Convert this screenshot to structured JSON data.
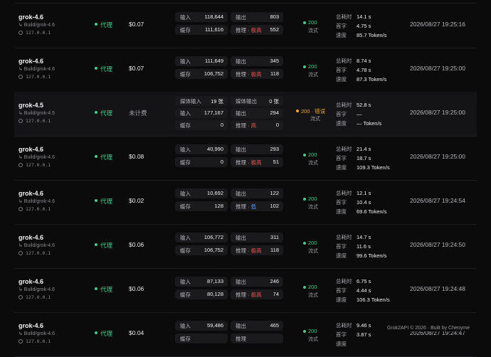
{
  "rows": [
    {
      "model": "grok-4.6",
      "route": "↳ Build/grok-4.6",
      "ip": "127.0.0.1",
      "agent": "代理",
      "cost": "$0.07",
      "cost_muted": false,
      "tokens": [
        {
          "a_label": "输入",
          "a_value": "118,644",
          "b_label": "输出",
          "b_value": "803"
        },
        {
          "a_label": "缓存",
          "a_value": "111,616",
          "b_label": "推理",
          "b_level": "极高",
          "b_level_kind": "extreme",
          "b_value": "552"
        }
      ],
      "status": "200",
      "status_error": false,
      "mode": "流式",
      "timing": [
        {
          "k": "总耗时",
          "v": "14.1 s"
        },
        {
          "k": "首字",
          "v": "4.75 s"
        },
        {
          "k": "速度",
          "v": "85.7 Token/s"
        }
      ],
      "time": "2026/08/27 19:25:16"
    },
    {
      "model": "grok-4.6",
      "route": "↳ Build/grok-4.6",
      "ip": "127.0.0.1",
      "agent": "代理",
      "cost": "$0.07",
      "cost_muted": false,
      "tokens": [
        {
          "a_label": "输入",
          "a_value": "111,649",
          "b_label": "输出",
          "b_value": "345"
        },
        {
          "a_label": "缓存",
          "a_value": "106,752",
          "b_label": "推理",
          "b_level": "极高",
          "b_level_kind": "extreme",
          "b_value": "118"
        }
      ],
      "status": "200",
      "status_error": false,
      "mode": "流式",
      "timing": [
        {
          "k": "总耗时",
          "v": "8.74 s"
        },
        {
          "k": "首字",
          "v": "4.78 s"
        },
        {
          "k": "速度",
          "v": "87.3 Token/s"
        }
      ],
      "time": "2026/08/27 19:25:00"
    },
    {
      "model": "grok-4.5",
      "route": "↳ Build/grok-4.5",
      "ip": "127.0.0.1",
      "agent": "代理",
      "cost": "未计费",
      "cost_muted": true,
      "highlight": true,
      "tokens": [
        {
          "a_label": "媒体输入",
          "a_value": "19 张",
          "b_label": "媒体输出",
          "b_value": "0 张"
        },
        {
          "a_label": "输入",
          "a_value": "177,167",
          "b_label": "输出",
          "b_value": "294"
        },
        {
          "a_label": "缓存",
          "a_value": "0",
          "b_label": "推理",
          "b_level": "高",
          "b_level_kind": "high",
          "b_value": "0"
        }
      ],
      "status": "200 · 错误",
      "status_error": true,
      "mode": "流式",
      "timing": [
        {
          "k": "总耗时",
          "v": "52.8 s"
        },
        {
          "k": "首字",
          "v": "—"
        },
        {
          "k": "速度",
          "v": "— Token/s"
        }
      ],
      "time": "2026/08/27 19:25:00"
    },
    {
      "model": "grok-4.6",
      "route": "↳ Build/grok-4.6",
      "ip": "127.0.0.1",
      "agent": "代理",
      "cost": "$0.08",
      "cost_muted": false,
      "tokens": [
        {
          "a_label": "输入",
          "a_value": "40,990",
          "b_label": "输出",
          "b_value": "293"
        },
        {
          "a_label": "缓存",
          "a_value": "0",
          "b_label": "推理",
          "b_level": "极高",
          "b_level_kind": "extreme",
          "b_value": "51"
        }
      ],
      "status": "200",
      "status_error": false,
      "mode": "流式",
      "timing": [
        {
          "k": "总耗时",
          "v": "21.4 s"
        },
        {
          "k": "首字",
          "v": "18.7 s"
        },
        {
          "k": "速度",
          "v": "109.3 Token/s"
        }
      ],
      "time": "2026/08/27 19:25:00"
    },
    {
      "model": "grok-4.6",
      "route": "↳ Build/grok-4.6",
      "ip": "127.0.0.1",
      "agent": "代理",
      "cost": "$0.02",
      "cost_muted": false,
      "tokens": [
        {
          "a_label": "输入",
          "a_value": "10,692",
          "b_label": "输出",
          "b_value": "122"
        },
        {
          "a_label": "缓存",
          "a_value": "128",
          "b_label": "推理",
          "b_level": "低",
          "b_level_kind": "low",
          "b_value": "102"
        }
      ],
      "status": "200",
      "status_error": false,
      "mode": "流式",
      "timing": [
        {
          "k": "总耗时",
          "v": "12.1 s"
        },
        {
          "k": "首字",
          "v": "10.4 s"
        },
        {
          "k": "速度",
          "v": "69.6 Token/s"
        }
      ],
      "time": "2026/08/27 19:24:54"
    },
    {
      "model": "grok-4.6",
      "route": "↳ Build/grok-4.6",
      "ip": "127.0.0.1",
      "agent": "代理",
      "cost": "$0.06",
      "cost_muted": false,
      "tokens": [
        {
          "a_label": "输入",
          "a_value": "106,772",
          "b_label": "输出",
          "b_value": "311"
        },
        {
          "a_label": "缓存",
          "a_value": "106,752",
          "b_label": "推理",
          "b_level": "极高",
          "b_level_kind": "extreme",
          "b_value": "118"
        }
      ],
      "status": "200",
      "status_error": false,
      "mode": "流式",
      "timing": [
        {
          "k": "总耗时",
          "v": "14.7 s"
        },
        {
          "k": "首字",
          "v": "11.6 s"
        },
        {
          "k": "速度",
          "v": "99.6 Token/s"
        }
      ],
      "time": "2026/08/27 19:24:50"
    },
    {
      "model": "grok-4.6",
      "route": "↳ Build/grok-4.6",
      "ip": "127.0.0.1",
      "agent": "代理",
      "cost": "$0.06",
      "cost_muted": false,
      "tokens": [
        {
          "a_label": "输入",
          "a_value": "87,133",
          "b_label": "输出",
          "b_value": "246"
        },
        {
          "a_label": "缓存",
          "a_value": "80,128",
          "b_label": "推理",
          "b_level": "极高",
          "b_level_kind": "extreme",
          "b_value": "74"
        }
      ],
      "status": "200",
      "status_error": false,
      "mode": "流式",
      "timing": [
        {
          "k": "总耗时",
          "v": "6.75 s"
        },
        {
          "k": "首字",
          "v": "4.44 s"
        },
        {
          "k": "速度",
          "v": "106.3 Token/s"
        }
      ],
      "time": "2026/08/27 19:24:48"
    },
    {
      "model": "grok-4.6",
      "route": "↳ Build/grok-4.6",
      "ip": "127.0.0.1",
      "agent": "代理",
      "cost": "$0.04",
      "cost_muted": false,
      "tokens": [
        {
          "a_label": "输入",
          "a_value": "59,486",
          "b_label": "输出",
          "b_value": "465"
        },
        {
          "a_label": "缓存",
          "a_value": "",
          "b_label": "推理",
          "b_level": "",
          "b_level_kind": "",
          "b_value": ""
        }
      ],
      "status": "200",
      "status_error": false,
      "mode": "流式",
      "timing": [
        {
          "k": "总耗时",
          "v": "9.46 s"
        },
        {
          "k": "首字",
          "v": "3.87 s"
        },
        {
          "k": "速度",
          "v": ""
        }
      ],
      "time": "2026/08/27 19:24:47"
    }
  ],
  "footer": "Grok2API © 2026 · Built by Chenyme",
  "colors": {
    "accent_green": "#3ecf8e",
    "error_orange": "#f5a623",
    "level_red": "#ef5350",
    "level_blue": "#5aa9ff"
  }
}
